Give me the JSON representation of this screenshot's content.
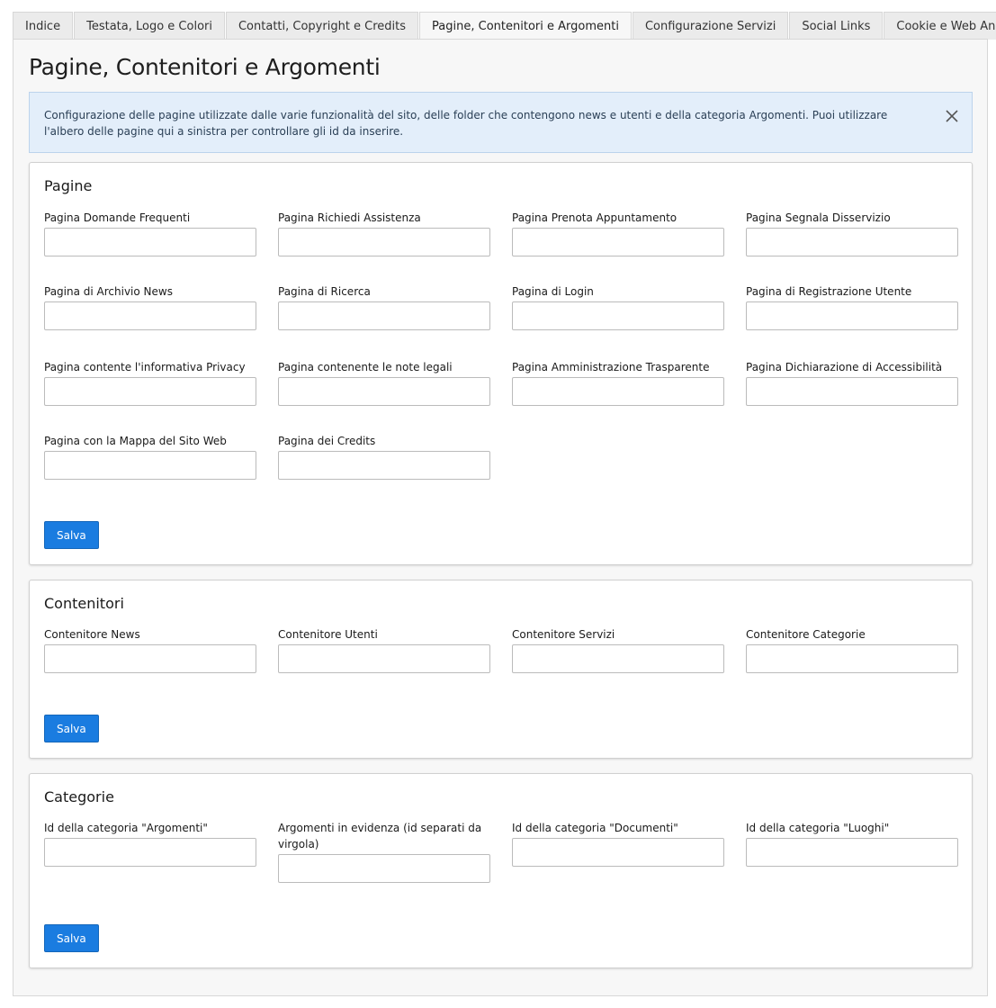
{
  "tabs": [
    {
      "label": "Indice"
    },
    {
      "label": "Testata, Logo e Colori"
    },
    {
      "label": "Contatti, Copyright e Credits"
    },
    {
      "label": "Pagine, Contenitori e Argomenti"
    },
    {
      "label": "Configurazione Servizi"
    },
    {
      "label": "Social Links"
    },
    {
      "label": "Cookie e Web Analytics"
    }
  ],
  "active_tab": "Pagine, Contenitori e Argomenti",
  "page": {
    "title": "Pagine, Contenitori e Argomenti",
    "info_text": "Configurazione delle pagine utilizzate dalle varie funzionalità del sito, delle folder che contengono news e utenti e della categoria Argomenti. Puoi utilizzare l'albero delle pagine qui a sinistra per controllare gli id da inserire."
  },
  "sections": {
    "pagine": {
      "title": "Pagine",
      "save_label": "Salva",
      "fields": [
        {
          "label": "Pagina Domande Frequenti",
          "value": ""
        },
        {
          "label": "Pagina Richiedi Assistenza",
          "value": ""
        },
        {
          "label": "Pagina Prenota Appuntamento",
          "value": ""
        },
        {
          "label": "Pagina Segnala Disservizio",
          "value": ""
        },
        {
          "label": "Pagina di Archivio News",
          "value": ""
        },
        {
          "label": "Pagina di Ricerca",
          "value": ""
        },
        {
          "label": "Pagina di Login",
          "value": ""
        },
        {
          "label": "Pagina di Registrazione Utente",
          "value": ""
        },
        {
          "label": "Pagina contente l'informativa Privacy",
          "value": ""
        },
        {
          "label": "Pagina contenente le note legali",
          "value": ""
        },
        {
          "label": "Pagina Amministrazione Trasparente",
          "value": ""
        },
        {
          "label": "Pagina Dichiarazione di Accessibilità",
          "value": ""
        },
        {
          "label": "Pagina con la Mappa del Sito Web",
          "value": ""
        },
        {
          "label": "Pagina dei Credits",
          "value": ""
        }
      ]
    },
    "contenitori": {
      "title": "Contenitori",
      "save_label": "Salva",
      "fields": [
        {
          "label": "Contenitore News",
          "value": ""
        },
        {
          "label": "Contenitore Utenti",
          "value": ""
        },
        {
          "label": "Contenitore Servizi",
          "value": ""
        },
        {
          "label": "Contenitore Categorie",
          "value": ""
        }
      ]
    },
    "categorie": {
      "title": "Categorie",
      "save_label": "Salva",
      "fields": [
        {
          "label": "Id della categoria \"Argomenti\"",
          "value": ""
        },
        {
          "label": "Argomenti in evidenza (id separati da virgola)",
          "value": ""
        },
        {
          "label": "Id della categoria \"Documenti\"",
          "value": ""
        },
        {
          "label": "Id della categoria \"Luoghi\"",
          "value": ""
        }
      ]
    }
  },
  "colors": {
    "accent": "#1a7ce0",
    "info_bg": "#e3eefa"
  },
  "icons": {
    "close": "close-icon"
  }
}
